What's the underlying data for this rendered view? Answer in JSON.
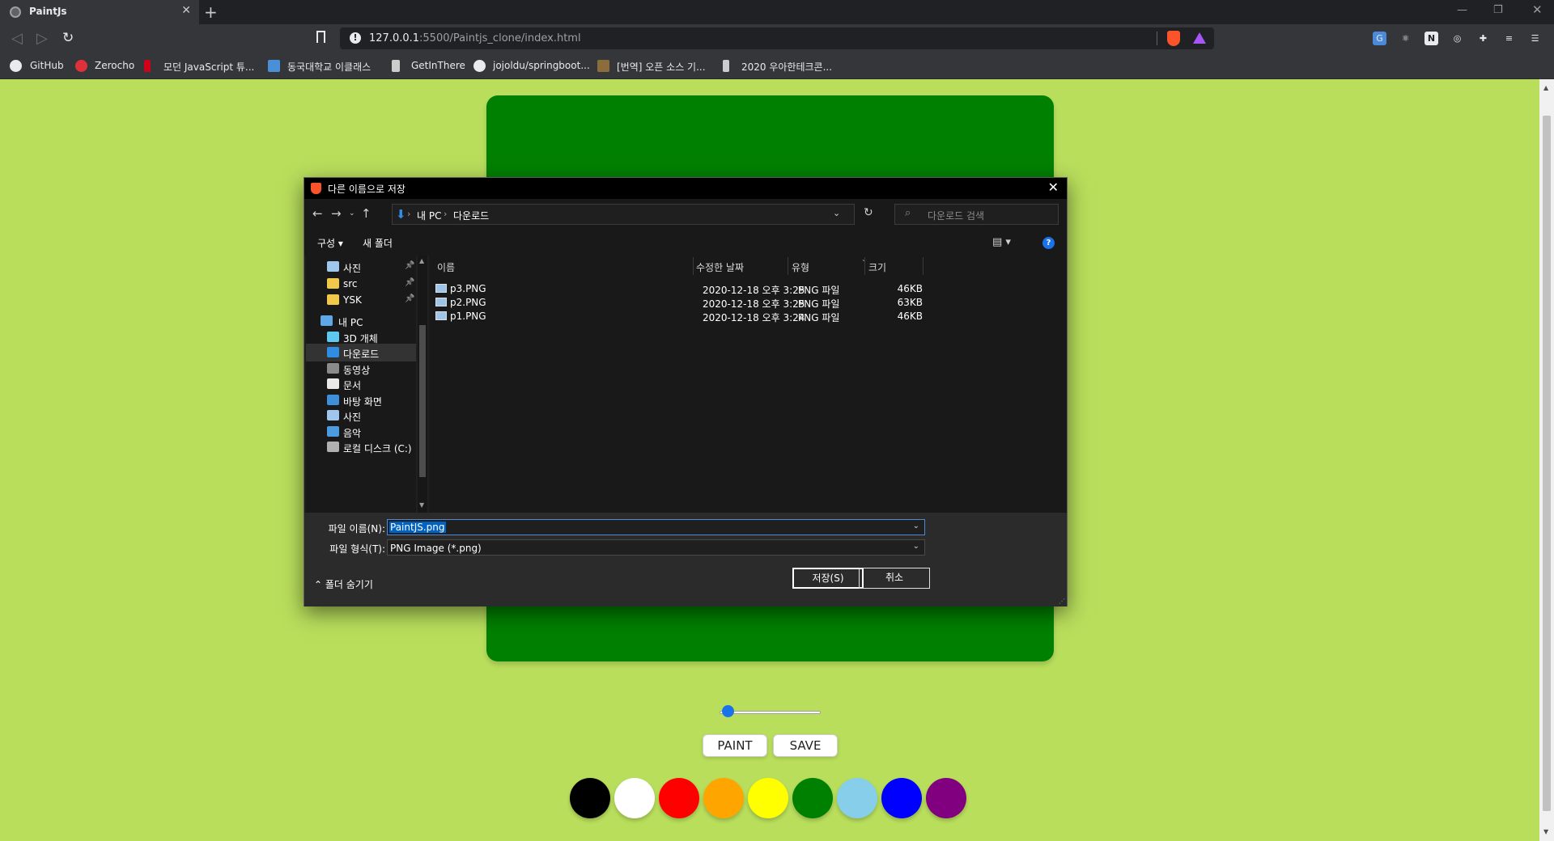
{
  "browser": {
    "tab_title": "PaintJs",
    "url_host": "127.0.0.1",
    "url_path": ":5500/Paintjs_clone/index.html",
    "bookmarks": [
      "GitHub",
      "Zerocho",
      "모던 JavaScript 튜...",
      "동국대학교 이클래스",
      "GetInThere",
      "jojoldu/springboot...",
      "[번역] 오픈 소스 기...",
      "2020 우아한테크콘..."
    ],
    "bookmark_icon_colors": [
      "#e8eaed",
      "#e0313b",
      "#d0021b",
      "#4a90d9",
      "#cccccc",
      "#e8eaed",
      "#8a6d3b",
      "#cccccc"
    ]
  },
  "app": {
    "canvas_color": "#008000",
    "page_bg": "#b8de5c",
    "brush_range_value": 0.025,
    "mode_button": "PAINT",
    "save_button": "SAVE",
    "palette": [
      "#000000",
      "#ffffff",
      "#ff0000",
      "#ffa500",
      "#ffff00",
      "#008000",
      "#87ceeb",
      "#0000ff",
      "#800080"
    ]
  },
  "dialog": {
    "title": "다른 이름으로 저장",
    "path": [
      "내 PC",
      "다운로드"
    ],
    "search_placeholder": "다운로드 검색",
    "organize": "구성 ▾",
    "new_folder": "새 폴더",
    "nav": [
      {
        "label": "사진",
        "pinned": true,
        "color": "#9fc7ee",
        "indent": 1
      },
      {
        "label": "src",
        "pinned": true,
        "color": "#f2c84b",
        "indent": 1
      },
      {
        "label": "YSK",
        "pinned": true,
        "color": "#f2c84b",
        "indent": 1
      },
      {
        "label": "내 PC",
        "pinned": false,
        "color": "#5fa8e8",
        "indent": 0
      },
      {
        "label": "3D 개체",
        "pinned": false,
        "color": "#5ec8f0",
        "indent": 1
      },
      {
        "label": "다운로드",
        "pinned": false,
        "color": "#2f8de4",
        "indent": 1,
        "selected": true
      },
      {
        "label": "동영상",
        "pinned": false,
        "color": "#8a8a8a",
        "indent": 1
      },
      {
        "label": "문서",
        "pinned": false,
        "color": "#e8e8e8",
        "indent": 1
      },
      {
        "label": "바탕 화면",
        "pinned": false,
        "color": "#3c8fd8",
        "indent": 1
      },
      {
        "label": "사진",
        "pinned": false,
        "color": "#9fc7ee",
        "indent": 1
      },
      {
        "label": "음악",
        "pinned": false,
        "color": "#4a9be0",
        "indent": 1
      },
      {
        "label": "로컬 디스크 (C:)",
        "pinned": false,
        "color": "#b0b0b0",
        "indent": 1
      }
    ],
    "columns": {
      "name": "이름",
      "modified": "수정한 날짜",
      "type": "유형",
      "size": "크기"
    },
    "files": [
      {
        "name": "p3.PNG",
        "modified": "2020-12-18 오후 3:25",
        "type": "PNG 파일",
        "size": "46KB"
      },
      {
        "name": "p2.PNG",
        "modified": "2020-12-18 오후 3:25",
        "type": "PNG 파일",
        "size": "63KB"
      },
      {
        "name": "p1.PNG",
        "modified": "2020-12-18 오후 3:24",
        "type": "PNG 파일",
        "size": "46KB"
      }
    ],
    "filename_label": "파일 이름(N):",
    "filename_value": "PaintJS.png",
    "filetype_label": "파일 형식(T):",
    "filetype_value": "PNG Image (*.png)",
    "hide_folders": "폴더 숨기기",
    "save": "저장(S)",
    "cancel": "취소"
  }
}
